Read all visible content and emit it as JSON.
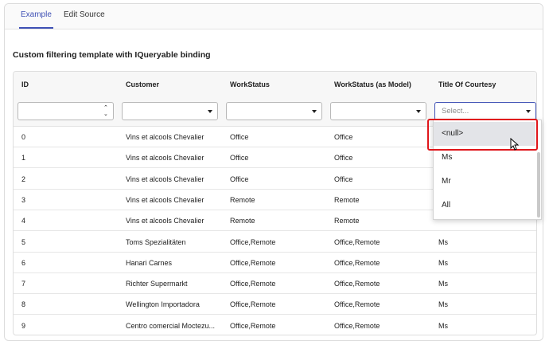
{
  "tabs": [
    {
      "label": "Example",
      "active": true
    },
    {
      "label": "Edit Source",
      "active": false
    }
  ],
  "demo_title": "Custom filtering template with IQueryable binding",
  "grid": {
    "columns": [
      "ID",
      "Customer",
      "WorkStatus",
      "WorkStatus (as Model)",
      "Title Of Courtesy"
    ],
    "filters": {
      "title_placeholder": "Select..."
    },
    "rows": [
      {
        "id": "0",
        "customer": "Vins et alcools Chevalier",
        "work": "Office",
        "work_model": "Office",
        "title": ""
      },
      {
        "id": "1",
        "customer": "Vins et alcools Chevalier",
        "work": "Office",
        "work_model": "Office",
        "title": ""
      },
      {
        "id": "2",
        "customer": "Vins et alcools Chevalier",
        "work": "Office",
        "work_model": "Office",
        "title": ""
      },
      {
        "id": "3",
        "customer": "Vins et alcools Chevalier",
        "work": "Remote",
        "work_model": "Remote",
        "title": ""
      },
      {
        "id": "4",
        "customer": "Vins et alcools Chevalier",
        "work": "Remote",
        "work_model": "Remote",
        "title": ""
      },
      {
        "id": "5",
        "customer": "Toms Spezialitäten",
        "work": "Office,Remote",
        "work_model": "Office,Remote",
        "title": "Ms"
      },
      {
        "id": "6",
        "customer": "Hanari Carnes",
        "work": "Office,Remote",
        "work_model": "Office,Remote",
        "title": "Ms"
      },
      {
        "id": "7",
        "customer": "Richter Supermarkt",
        "work": "Office,Remote",
        "work_model": "Office,Remote",
        "title": "Ms"
      },
      {
        "id": "8",
        "customer": "Wellington Importadora",
        "work": "Office,Remote",
        "work_model": "Office,Remote",
        "title": "Ms"
      },
      {
        "id": "9",
        "customer": "Centro comercial Moctezu...",
        "work": "Office,Remote",
        "work_model": "Office,Remote",
        "title": "Ms"
      }
    ]
  },
  "dropdown": {
    "options": [
      "<null>",
      "Ms",
      "Mr",
      "All"
    ],
    "hovered": "<null>"
  },
  "colors": {
    "accent": "#3f51b5",
    "highlight": "#e0161b"
  }
}
